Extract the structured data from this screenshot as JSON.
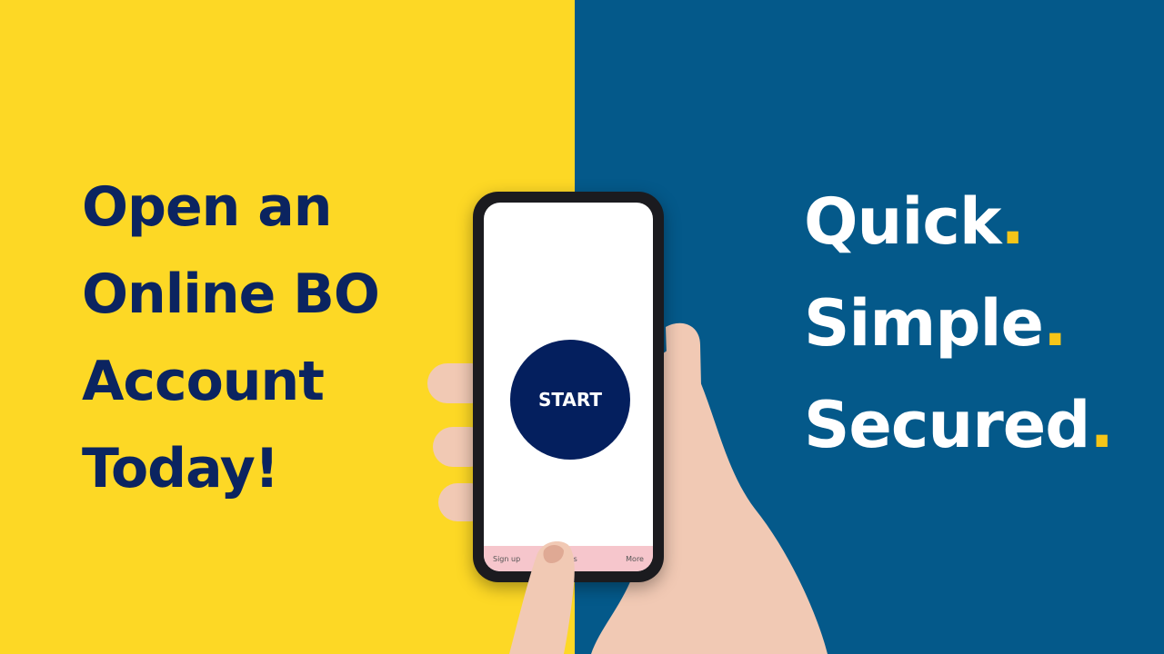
{
  "colors": {
    "yellow_bg": "#FDD825",
    "blue_bg": "#04598A",
    "navy_text": "#0B2460",
    "white_text": "#FFFFFF",
    "dot_yellow": "#F6C518",
    "start_circle": "#041F5E",
    "skin": "#F1C9B4",
    "skin_shadow": "#DFA994",
    "nav_bar": "#F6C6CC"
  },
  "headline": {
    "line1": "Open an",
    "line2": "Online BO",
    "line3": "Account",
    "line4": "Today!"
  },
  "tagline": {
    "line1": "Quick",
    "line2": "Simple",
    "line3": "Secured",
    "dot": "."
  },
  "phone": {
    "start_label": "START",
    "nav": {
      "left": "Sign up",
      "middle": "ns",
      "right": "More"
    }
  }
}
